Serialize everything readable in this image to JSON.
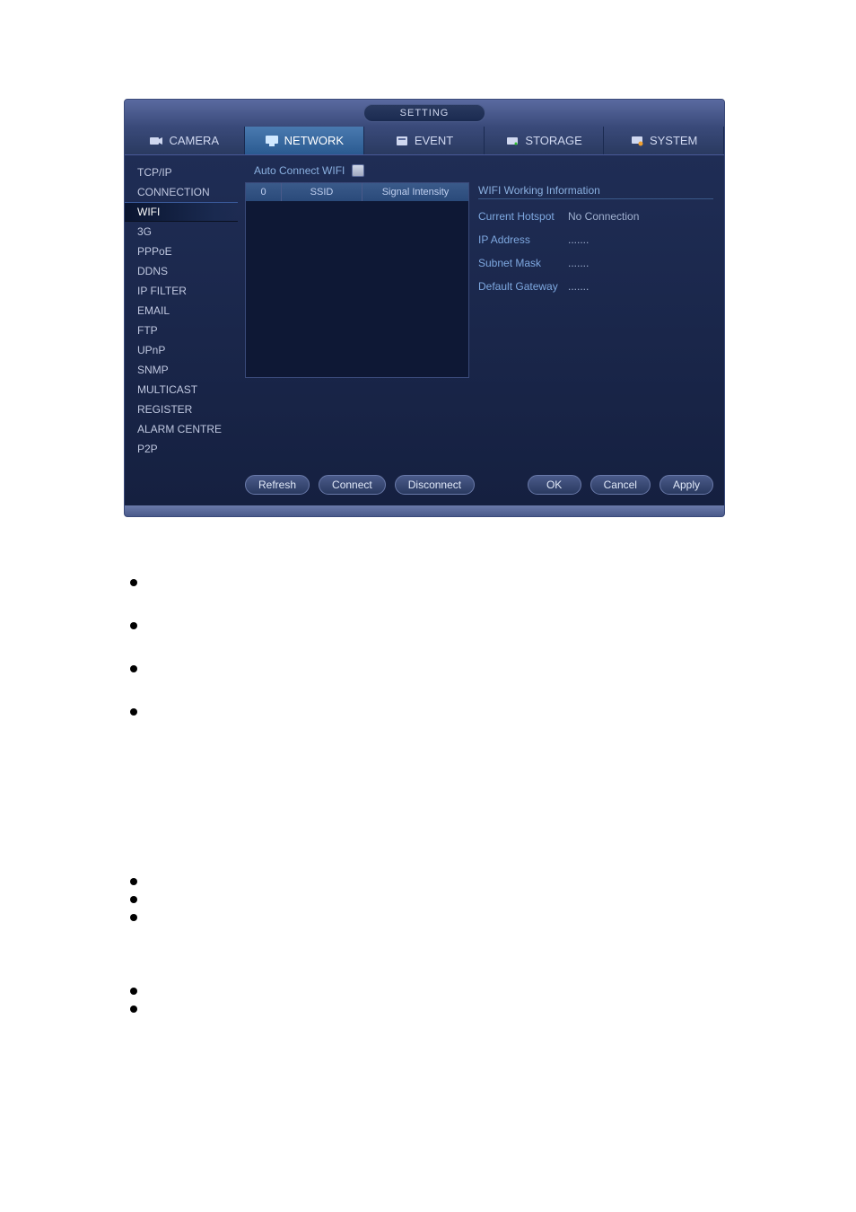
{
  "window": {
    "title": "SETTING"
  },
  "tabs": [
    {
      "label": "CAMERA",
      "icon": "camera-icon"
    },
    {
      "label": "NETWORK",
      "icon": "network-icon"
    },
    {
      "label": "EVENT",
      "icon": "event-icon"
    },
    {
      "label": "STORAGE",
      "icon": "storage-icon"
    },
    {
      "label": "SYSTEM",
      "icon": "system-icon"
    }
  ],
  "active_tab": "NETWORK",
  "sidebar": {
    "items": [
      "TCP/IP",
      "CONNECTION",
      "WIFI",
      "3G",
      "PPPoE",
      "DDNS",
      "IP FILTER",
      "EMAIL",
      "FTP",
      "UPnP",
      "SNMP",
      "MULTICAST",
      "REGISTER",
      "ALARM CENTRE",
      "P2P"
    ],
    "active": "WIFI"
  },
  "content": {
    "auto_connect_label": "Auto Connect WIFI",
    "auto_connect_checked": false,
    "table": {
      "headers": [
        "0",
        "SSID",
        "Signal Intensity"
      ]
    },
    "info": {
      "title": "WIFI Working Information",
      "rows": [
        {
          "label": "Current Hotspot",
          "value": "No Connection"
        },
        {
          "label": "IP Address",
          "value": "......."
        },
        {
          "label": "Subnet Mask",
          "value": "......."
        },
        {
          "label": "Default Gateway",
          "value": "......."
        }
      ]
    }
  },
  "buttons": {
    "refresh": "Refresh",
    "connect": "Connect",
    "disconnect": "Disconnect",
    "ok": "OK",
    "cancel": "Cancel",
    "apply": "Apply"
  }
}
